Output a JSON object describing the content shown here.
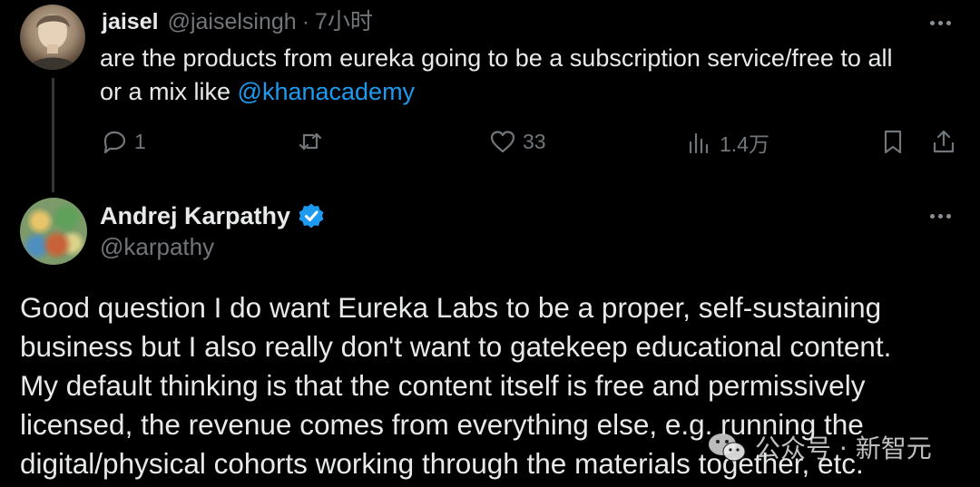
{
  "reply_tweet": {
    "author_name": "jaisel",
    "author_handle": "@jaiselsingh",
    "separator": "·",
    "time": "7小时",
    "text_lines": [
      "are the products from eureka going to be a subscription service/free to all",
      "or a mix like "
    ],
    "mention": "@khanacademy",
    "actions": {
      "reply_count": "1",
      "retweet_count": "",
      "like_count": "33",
      "views_count": "1.4万"
    }
  },
  "main_tweet": {
    "author_name": "Andrej Karpathy",
    "author_handle": "@karpathy",
    "verified": true,
    "text_lines": [
      "Good question I do want Eureka Labs to be a proper, self-sustaining",
      "business but I also really don't want to gatekeep educational content.",
      "My default thinking is that the content itself is free and permissively",
      "licensed, the revenue comes from everything else, e.g. running the",
      "digital/physical cohorts working through the materials together, etc."
    ]
  },
  "watermark": {
    "text": "公众号 · 新智元"
  },
  "icons": {
    "more": "more-horizontal-icon",
    "reply": "reply-bubble-icon",
    "retweet": "retweet-icon",
    "like": "heart-icon",
    "views": "views-bar-chart-icon",
    "bookmark": "bookmark-icon",
    "share": "share-upload-icon",
    "verified": "verified-badge-icon"
  },
  "colors": {
    "background": "#000000",
    "text": "#e7e9ea",
    "secondary": "#71767b",
    "link": "#1d9bf0",
    "verified": "#1d9bf0"
  }
}
